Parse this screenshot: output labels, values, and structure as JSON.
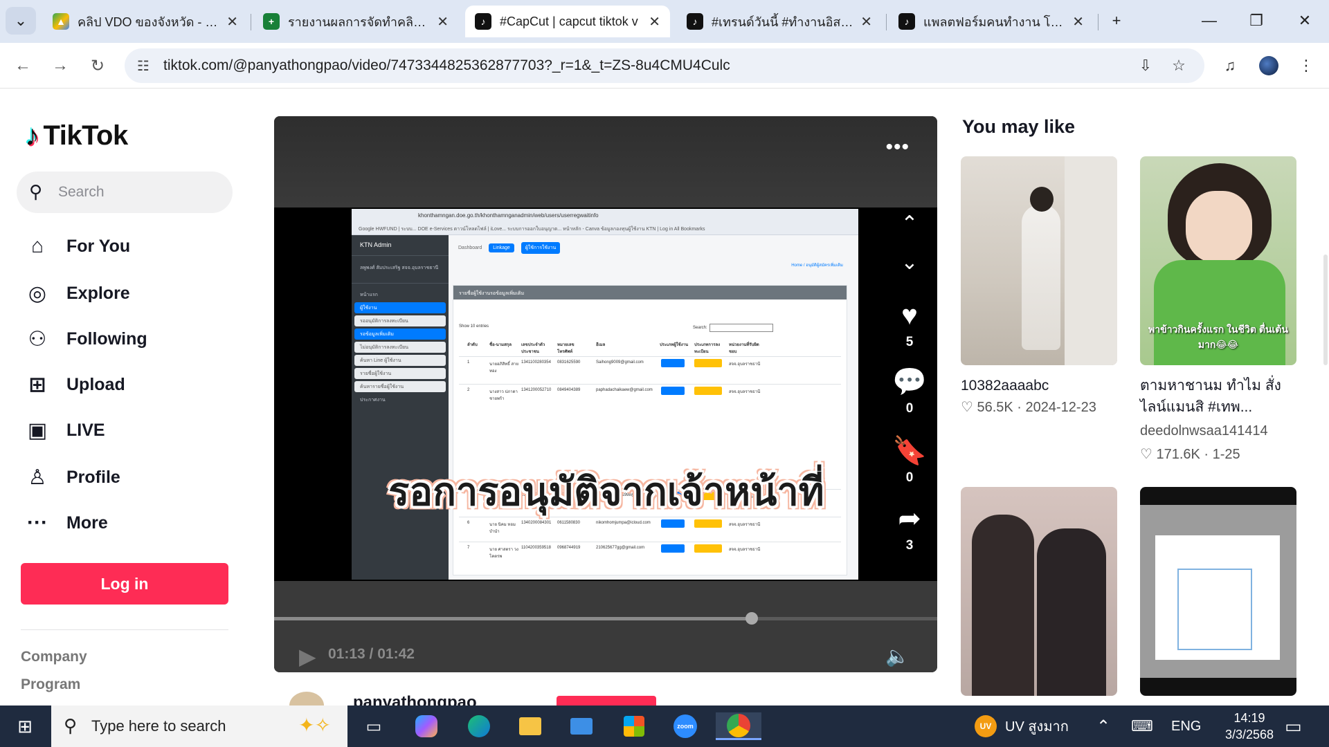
{
  "browser": {
    "tabs": [
      {
        "title": "คลิป VDO ของจังหวัด - Goo",
        "icon": "google-drive-icon",
        "color": "#fbbc04"
      },
      {
        "title": "รายงานผลการจัดทำคลิป VD",
        "icon": "google-sheets-icon",
        "color": "#188038"
      },
      {
        "title": "#CapCut | capcut tiktok v",
        "icon": "tiktok-icon",
        "color": "#111111"
      },
      {
        "title": "#เทรนด์วันนี้ #ทำงานอิสระ #",
        "icon": "tiktok-icon",
        "color": "#111111"
      },
      {
        "title": "แพลตฟอร์มคนทำงาน โดยกร",
        "icon": "tiktok-icon",
        "color": "#111111"
      }
    ],
    "url": "tiktok.com/@panyathongpao/video/7473344825362877703?_r=1&_t=ZS-8u4CMU4Culc"
  },
  "sidebar": {
    "logo": "TikTok",
    "search_placeholder": "Search",
    "nav": [
      {
        "label": "For You",
        "icon": "home-icon"
      },
      {
        "label": "Explore",
        "icon": "compass-icon"
      },
      {
        "label": "Following",
        "icon": "following-icon"
      },
      {
        "label": "Upload",
        "icon": "upload-icon"
      },
      {
        "label": "LIVE",
        "icon": "live-icon"
      },
      {
        "label": "Profile",
        "icon": "profile-icon"
      },
      {
        "label": "More",
        "icon": "more-icon"
      }
    ],
    "login_label": "Log in",
    "footer_links": [
      "Company",
      "Program"
    ]
  },
  "video": {
    "caption_overlay": "รอการอนุมัติจากเจ้าหน้าที่",
    "likes": "5",
    "comments": "0",
    "saves": "0",
    "shares": "3",
    "current_time": "01:13",
    "duration": "01:42",
    "progress": 0.72,
    "author": "panyathongpao",
    "inner_screen": {
      "url": "khonthamngan.doe.go.th/khonthamnganadmin/web/users/userregwaitinfo",
      "bookmarks": "Google   HWFUND | ระบบ...   DOE e-Services   ตาวน์โหลดไฟล์ | iLove...   ระบบการออกใบอนุญาต...   หน้าหลัก - Canva   ข้อมูลกองทุนผู้ใช้งาน   KTN | Log in   All Bookmarks",
      "brand": "KTN Admin",
      "user": "ลพูพงศ์ สัมประเสริฐ สจจ.อุบลราชธานี",
      "menu": [
        "หน้าแรก",
        "ผู้ใช้งาน",
        "รออนุมัติการลงทะเบียน",
        "รอข้อมูลเพิ่มเติม",
        "ไม่อนุมัติการลงทะเบียน",
        "ค้นหา Line ผู้ใช้งาน",
        "รายชื่อผู้ใช้งาน",
        "ค้นหารายชื่อผู้ใช้งาน",
        "ประกาศงาน"
      ],
      "topnav": [
        "Dashboard",
        "Linkage",
        "ผู้ใช้การใช้งาน"
      ],
      "breadcrumb": "Home / อนุมัติผู้สมัครเพิ่มเติม",
      "card_title": "รายชื่อผู้ใช้งานรอข้อมูลเพิ่มเติม",
      "show_entries": "Show 10 entries",
      "search_label": "Search:",
      "headers": [
        "ลำดับ",
        "ชื่อ-นามสกุล",
        "เลขประจำตัวประชาชน",
        "หมายเลขโทรศัพท์",
        "อีเมล",
        "ประเภทผู้ใช้งาน",
        "ประเภทการลงทะเบียน",
        "หน่วยงานที่รับผิดชอบ"
      ],
      "rows": [
        {
          "no": "1",
          "name": "นายอภิสิทธิ์ สายทอง",
          "id": "1341100280354",
          "phone": "0831625590",
          "email": "Saihong9009@gmail.com",
          "org": "สจจ.อุบลราชธานี"
        },
        {
          "no": "2",
          "name": "นางสาว ปภาดา ชายพร้า",
          "id": "1341200052710",
          "phone": "0849404389",
          "email": "paphadachaikaew@gmail.com",
          "org": "สจจ.อุบลราชธานี"
        },
        {
          "no": "5",
          "name": "นางสาว Suwanan Kanyaphan",
          "id": "1340900280145",
          "phone": "0822353407",
          "email": "suwanan23041998@gmail.com",
          "org": "สจจ.อุบลราชธานี"
        },
        {
          "no": "6",
          "name": "นาย นิคม หอมบำนำ",
          "id": "1340200084301",
          "phone": "0611580830",
          "email": "nikomhomjumpa@icloud.com",
          "org": "สจจ.อุบลราชธานี"
        },
        {
          "no": "7",
          "name": "นาย ศาสตรา วงโคตรพ",
          "id": "1104200359518",
          "phone": "0968744919",
          "email": "210625677gg@gmail.com",
          "org": "สจจ.อุบลราชธานี"
        }
      ]
    }
  },
  "recommendations": {
    "title": "You may like",
    "items": [
      {
        "caption": "10382aaaabc",
        "meta": "♡ 56.5K · 2024-12-23",
        "thumb_bg": "#d7d2cb"
      },
      {
        "caption": "ตามหาชานม ทำไม สั่งไลน์แมนสิ #เทพ...",
        "author": "deedolnwsaa141414",
        "meta": "♡ 171.6K · 1-25",
        "overlay": "พาข้าวกินครั้งแรก ในชีวิต ตื่นเต้นมาก😂😂",
        "thumb_bg": "#b9d3a8"
      },
      {
        "caption": "",
        "meta": "",
        "thumb_bg": "#c8b6b0"
      },
      {
        "caption": "",
        "meta": "",
        "thumb_bg": "#9c9c9c"
      }
    ]
  },
  "taskbar": {
    "search_placeholder": "Type here to search",
    "weather": "UV สูงมาก",
    "language": "ENG",
    "time": "14:19",
    "date": "3/3/2568"
  }
}
